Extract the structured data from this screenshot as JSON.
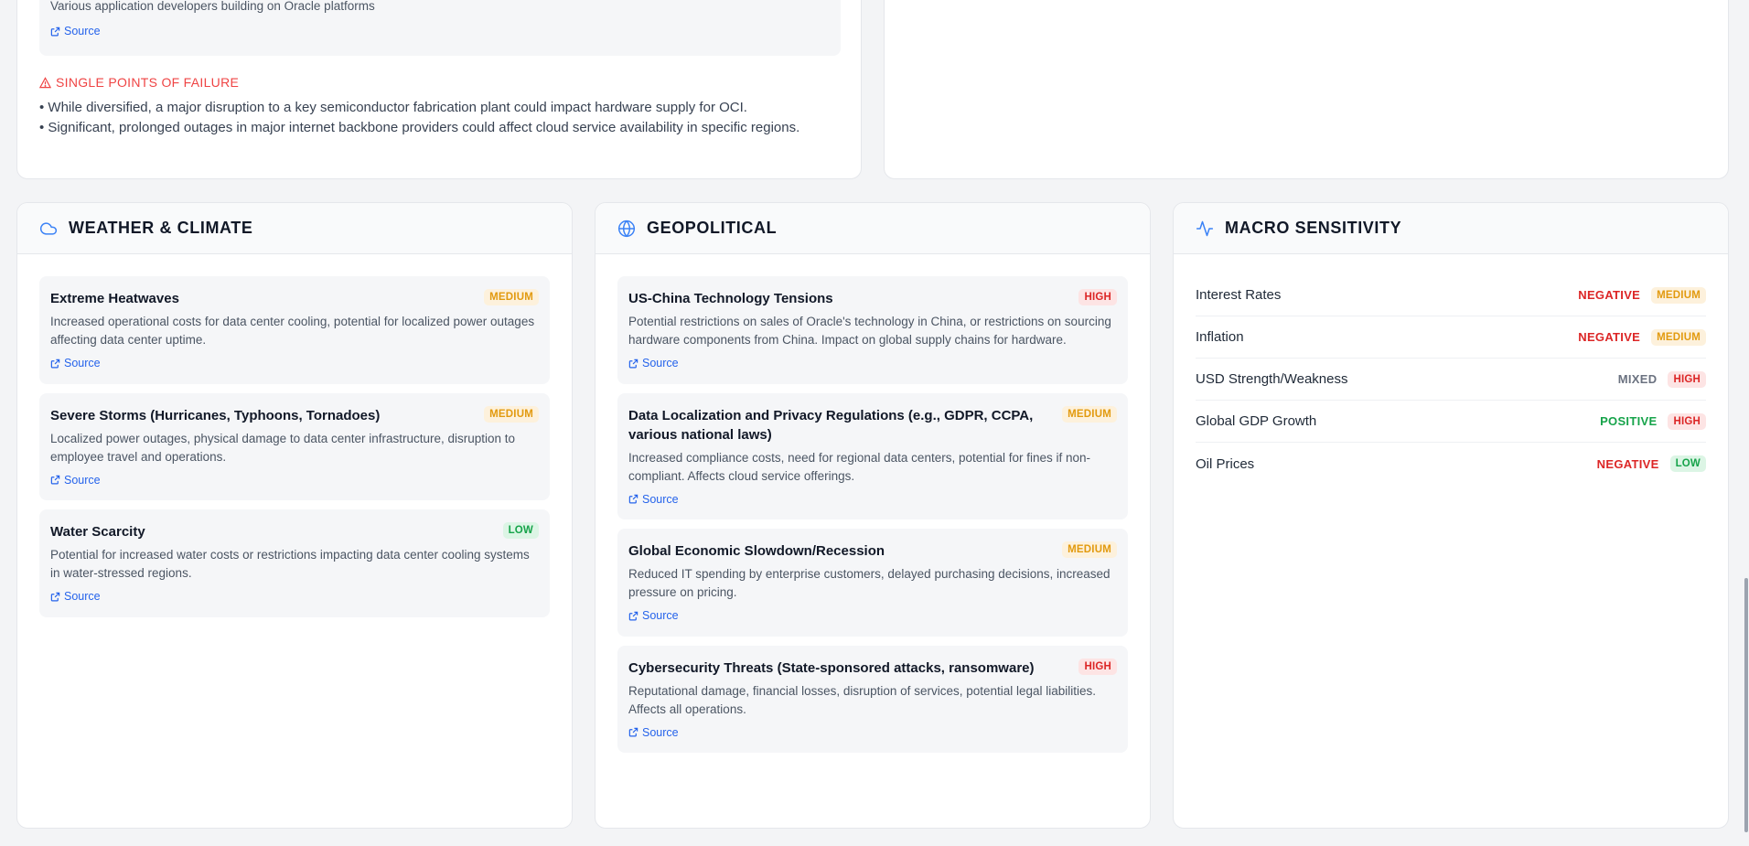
{
  "top": {
    "partial_desc": "Various application developers building on Oracle platforms",
    "source_label": "Source",
    "spof_title": "SINGLE POINTS OF FAILURE",
    "spof_items": [
      "• While diversified, a major disruption to a key semiconductor fabrication plant could impact hardware supply for OCI.",
      "• Significant, prolonged outages in major internet backbone providers could affect cloud service availability in specific regions."
    ]
  },
  "weather": {
    "title": "WEATHER & CLIMATE",
    "icon": "cloud-icon",
    "items": [
      {
        "title": "Extreme Heatwaves",
        "level": "MEDIUM",
        "desc": "Increased operational costs for data center cooling, potential for localized power outages affecting data center uptime.",
        "source": "Source"
      },
      {
        "title": "Severe Storms (Hurricanes, Typhoons, Tornadoes)",
        "level": "MEDIUM",
        "desc": "Localized power outages, physical damage to data center infrastructure, disruption to employee travel and operations.",
        "source": "Source"
      },
      {
        "title": "Water Scarcity",
        "level": "LOW",
        "desc": "Potential for increased water costs or restrictions impacting data center cooling systems in water-stressed regions.",
        "source": "Source"
      }
    ]
  },
  "geo": {
    "title": "GEOPOLITICAL",
    "icon": "globe-icon",
    "items": [
      {
        "title": "US-China Technology Tensions",
        "level": "HIGH",
        "desc": "Potential restrictions on sales of Oracle's technology in China, or restrictions on sourcing hardware components from China. Impact on global supply chains for hardware.",
        "source": "Source"
      },
      {
        "title": "Data Localization and Privacy Regulations (e.g., GDPR, CCPA, various national laws)",
        "level": "MEDIUM",
        "desc": "Increased compliance costs, need for regional data centers, potential for fines if non-compliant. Affects cloud service offerings.",
        "source": "Source"
      },
      {
        "title": "Global Economic Slowdown/Recession",
        "level": "MEDIUM",
        "desc": "Reduced IT spending by enterprise customers, delayed purchasing decisions, increased pressure on pricing.",
        "source": "Source"
      },
      {
        "title": "Cybersecurity Threats (State-sponsored attacks, ransomware)",
        "level": "HIGH",
        "desc": "Reputational damage, financial losses, disruption of services, potential legal liabilities. Affects all operations.",
        "source": "Source"
      }
    ]
  },
  "macro": {
    "title": "MACRO SENSITIVITY",
    "icon": "activity-icon",
    "rows": [
      {
        "label": "Interest Rates",
        "direction": "NEGATIVE",
        "level": "MEDIUM"
      },
      {
        "label": "Inflation",
        "direction": "NEGATIVE",
        "level": "MEDIUM"
      },
      {
        "label": "USD Strength/Weakness",
        "direction": "MIXED",
        "level": "HIGH"
      },
      {
        "label": "Global GDP Growth",
        "direction": "POSITIVE",
        "level": "HIGH"
      },
      {
        "label": "Oil Prices",
        "direction": "NEGATIVE",
        "level": "LOW"
      }
    ]
  }
}
